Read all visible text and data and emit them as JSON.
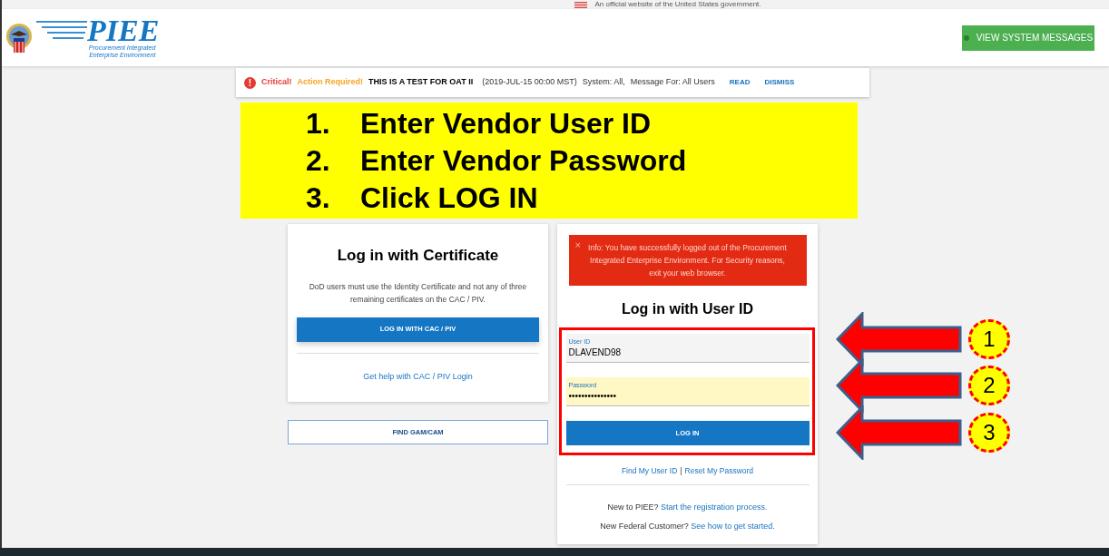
{
  "gov_banner": {
    "text": "An official website of the United States government."
  },
  "header": {
    "logo": {
      "title": "PIEE",
      "subtitle": [
        "Procurement Integrated",
        "Enterprise Environment"
      ]
    },
    "messages_button": "VIEW SYSTEM MESSAGES"
  },
  "alert": {
    "icon": "!",
    "severity": "Critical!",
    "action": "Action Required!",
    "title": "THIS IS A TEST FOR OAT II",
    "date": "(2019-JUL-15 00:00 MST)",
    "system": "System: All,",
    "audience": "Message For: All Users",
    "links": [
      "READ",
      "DISMISS"
    ]
  },
  "instructions": [
    {
      "number": "1.",
      "text": "Enter Vendor User ID"
    },
    {
      "number": "2.",
      "text": "Enter Vendor Password"
    },
    {
      "number": "3.",
      "text": "Click LOG IN"
    }
  ],
  "certificate_card": {
    "title": "Log in with Certificate",
    "description": "DoD users must use the Identity Certificate and not any of three remaining certificates on the CAC / PIV.",
    "button": "LOG IN WITH CAC / PIV",
    "help_link": "Get help with CAC / PIV Login"
  },
  "find_button": "FIND GAM/CAM",
  "user_id_card": {
    "info": {
      "close": "×",
      "text": "Info: You have successfully logged out of the Procurement Integrated Enterprise Environment. For Security reasons, exit your web browser."
    },
    "title": "Log in with User ID",
    "fields": [
      {
        "label": "User ID",
        "value": "DLAVEND98",
        "autofilled": false
      },
      {
        "label": "Password",
        "value": "•••••••••••••••",
        "autofilled": true
      }
    ],
    "button": "LOG IN",
    "links": [
      "Find My User ID",
      "Reset My Password"
    ],
    "separator": "|",
    "prompts": [
      {
        "text": "New to PIEE?",
        "link": "Start the registration process."
      },
      {
        "text": "New Federal Customer?",
        "link": "See how to get started."
      }
    ]
  },
  "callouts": [
    "1",
    "2",
    "3"
  ]
}
